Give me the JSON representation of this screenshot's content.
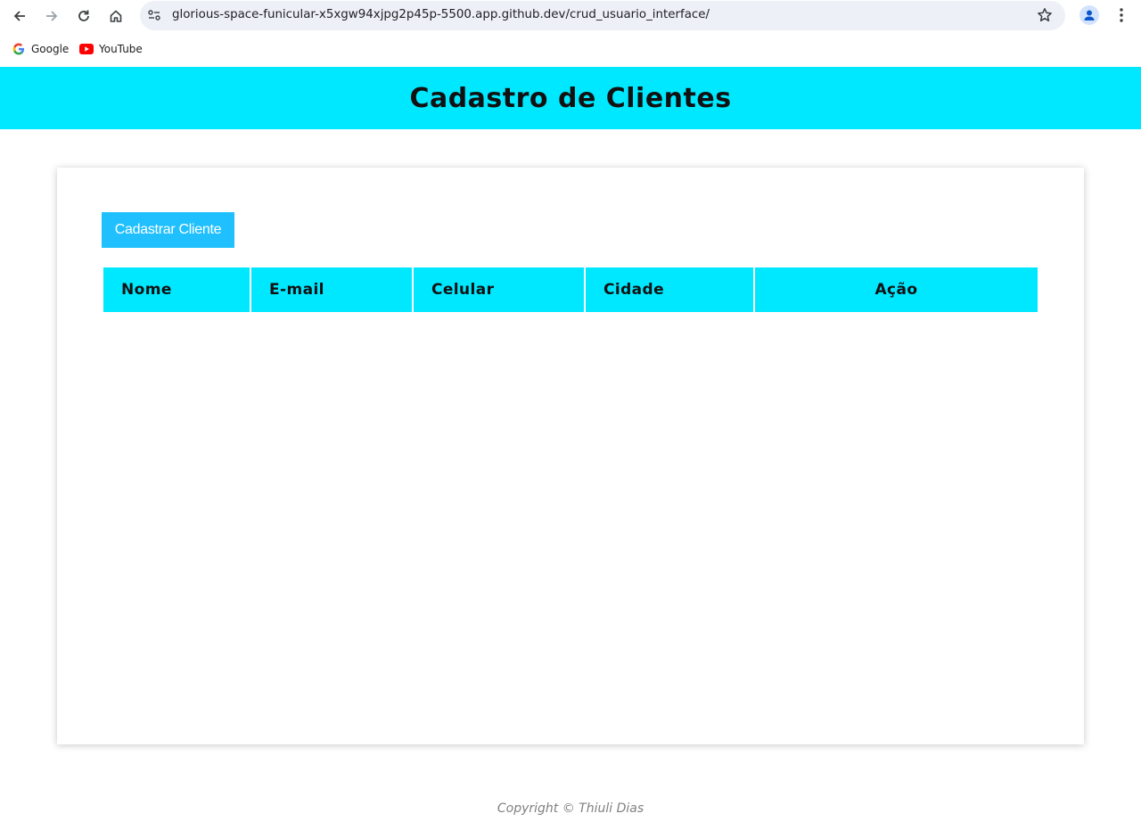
{
  "browser": {
    "url": "glorious-space-funicular-x5xgw94xjpg2p45p-5500.app.github.dev/crud_usuario_interface/",
    "bookmarks": [
      {
        "label": "Google",
        "icon": "google-icon"
      },
      {
        "label": "YouTube",
        "icon": "youtube-icon"
      }
    ]
  },
  "header": {
    "title": "Cadastro de Clientes",
    "color": "#00e8ff"
  },
  "main": {
    "add_button_label": "Cadastrar Cliente",
    "add_button_color": "#20c0ff",
    "table": {
      "columns": [
        "Nome",
        "E-mail",
        "Celular",
        "Cidade",
        "Ação"
      ],
      "rows": []
    }
  },
  "footer": {
    "text": "Copyright © Thiuli Dias"
  }
}
